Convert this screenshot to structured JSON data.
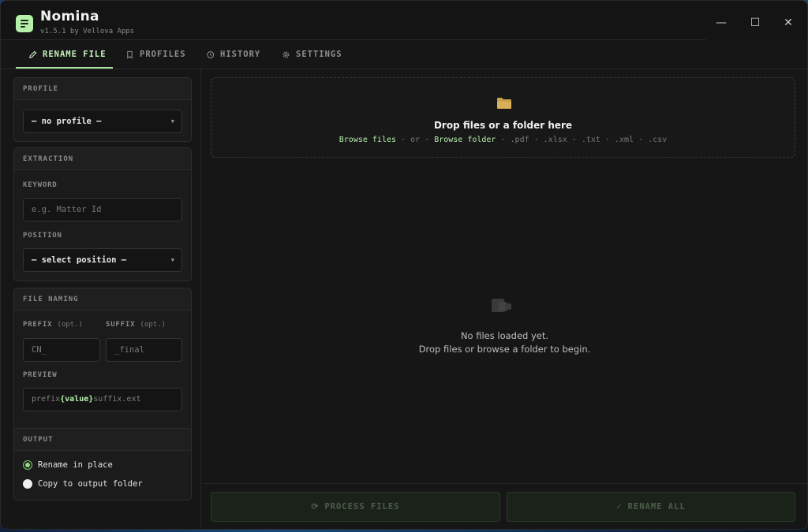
{
  "app": {
    "name": "Nomina",
    "version": "v1.5.1 by Vellova Apps"
  },
  "window_controls": {
    "minimize": "—",
    "maximize": "☐",
    "close": "✕"
  },
  "tabs": [
    {
      "label": "RENAME FILE",
      "icon": "pencil-icon",
      "active": true
    },
    {
      "label": "PROFILES",
      "icon": "bookmark-icon",
      "active": false
    },
    {
      "label": "HISTORY",
      "icon": "history-icon",
      "active": false
    },
    {
      "label": "SETTINGS",
      "icon": "gear-icon",
      "active": false
    }
  ],
  "sidebar": {
    "profile": {
      "heading": "PROFILE",
      "selected": "— no profile —"
    },
    "extraction": {
      "heading": "EXTRACTION",
      "keyword_label": "KEYWORD",
      "keyword_placeholder": "e.g. Matter Id",
      "position_label": "POSITION",
      "position_selected": "— select position —"
    },
    "naming": {
      "heading": "FILE NAMING",
      "prefix_label": "PREFIX",
      "prefix_opt": "(opt.)",
      "prefix_placeholder": "CN_",
      "suffix_label": "SUFFIX",
      "suffix_opt": "(opt.)",
      "suffix_placeholder": "_final",
      "preview_label": "PREVIEW",
      "preview_prefix": "prefix",
      "preview_value": "{value}",
      "preview_suffix": "suffix.ext"
    },
    "output": {
      "heading": "OUTPUT",
      "options": [
        {
          "label": "Rename in place",
          "selected": true
        },
        {
          "label": "Copy to output folder",
          "selected": false
        }
      ]
    }
  },
  "dropzone": {
    "title": "Drop files or a folder here",
    "browse_files": "Browse files",
    "or": " · or · ",
    "browse_folder": "Browse folder",
    "extensions": " · .pdf · .xlsx · .txt · .xml · .csv"
  },
  "empty_state": {
    "line1": "No files loaded yet.",
    "line2": "Drop files or browse a folder to begin."
  },
  "actions": {
    "process": "PROCESS FILES",
    "rename_all": "RENAME ALL"
  },
  "colors": {
    "accent": "#b6f0ab",
    "background": "#161616",
    "folder": "#c9a04e"
  }
}
